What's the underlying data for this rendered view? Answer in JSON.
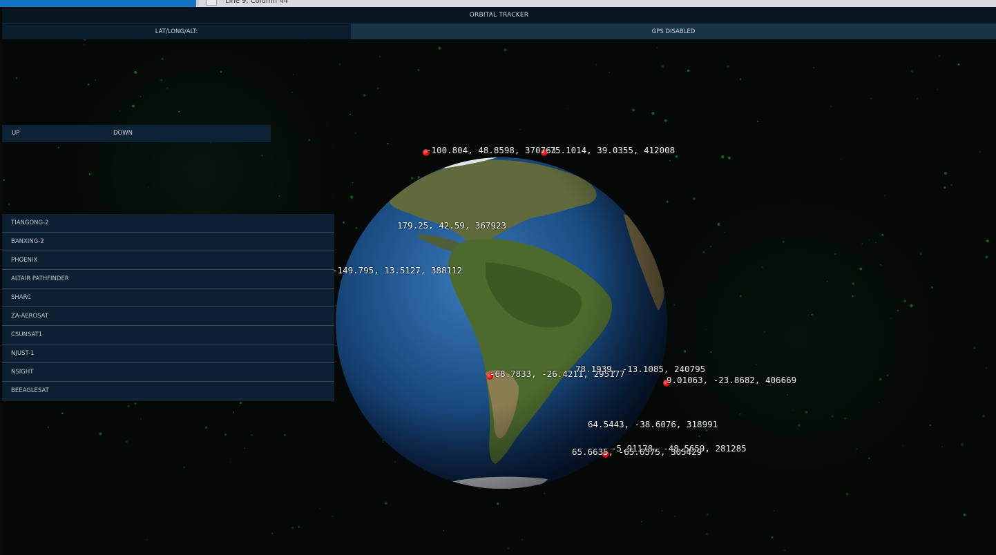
{
  "os_bar": {
    "status": "Line 9, Column 44"
  },
  "app": {
    "title": "ORBITAL TRACKER",
    "coords_label": "LAT/LONG/ALT:",
    "gps_status": "GPS DISABLED"
  },
  "pass_panel": {
    "up": "UP",
    "down": "DOWN"
  },
  "satellites": [
    "TIANGONG-2",
    "BANXING-2",
    "PHOENIX",
    "ALTAIR PATHFINDER",
    "SHARC",
    "ZA-AEROSAT",
    "CSUNSAT1",
    "NJUST-1",
    "NSIGHT",
    "BEEAGLESAT"
  ],
  "positions": [
    "-100.804, 48.8598, 370763",
    "-75.1014, 39.0355, 412008",
    "179.25, 42.59, 367923",
    "-149.795, 13.5127, 388112",
    "-68.7833, -26.4211, 295177",
    "78.1939, -13.1085, 240795",
    "9.01063, -23.8682, 406669",
    "64.5443, -38.6076, 318991",
    "-5.91178, -48.5659, 281285",
    "65.6635, -65.6575, 305429"
  ],
  "colors": {
    "panel": "#0c2031",
    "header": "#071521",
    "gps_bar": "#1a3447",
    "satellite_marker": "#e01010",
    "ocean": "#1b4f86"
  }
}
